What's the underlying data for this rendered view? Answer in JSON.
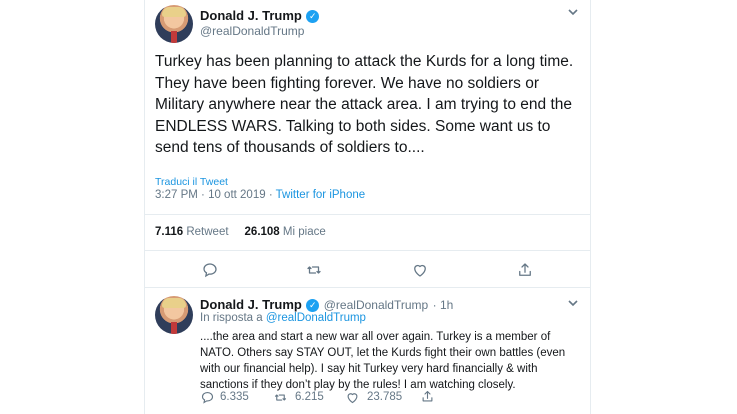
{
  "main_tweet": {
    "author_name": "Donald J. Trump",
    "author_handle": "@realDonaldTrump",
    "text": "Turkey has been planning to attack the Kurds for a long time. They have been fighting forever. We have no soldiers or Military anywhere near the attack area. I am trying to end the ENDLESS WARS. Talking to both sides. Some want us to send tens of thousands of soldiers to....",
    "translate_label": "Traduci il Tweet",
    "time": "3:27 PM",
    "date": "10 ott 2019",
    "source": "Twitter for iPhone",
    "retweets_count": "7.116",
    "retweets_label": "Retweet",
    "likes_count": "26.108",
    "likes_label": "Mi piace"
  },
  "reply_tweet": {
    "author_name": "Donald J. Trump",
    "author_handle": "@realDonaldTrump",
    "age": "1h",
    "reply_prefix": "In risposta a",
    "reply_handle": "@realDonaldTrump",
    "text": "....the area and start a new war all over again. Turkey is a member of NATO. Others say STAY OUT, let the Kurds fight their own battles (even with our financial help). I say hit Turkey very hard financially & with sanctions if they don’t play by the rules! I am watching closely.",
    "replies": "6.335",
    "retweets": "6.215",
    "likes": "23.785"
  },
  "colors": {
    "accent": "#1da1f2",
    "link": "#1b95e0",
    "muted": "#657786",
    "divider": "#e6ecf0"
  },
  "icons": [
    "verified-badge-icon",
    "chevron-down-icon",
    "reply-icon",
    "retweet-icon",
    "like-icon",
    "share-icon"
  ]
}
